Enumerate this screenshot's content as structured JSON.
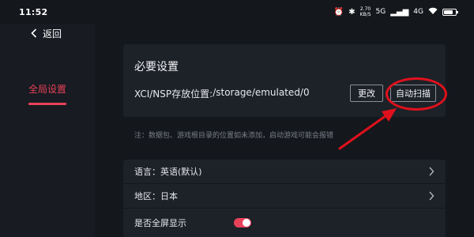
{
  "status_bar": {
    "time": "11:52",
    "net_speed_value": "2.70",
    "net_speed_unit": "KB/S",
    "signal_label": "5G",
    "signal2_label": "4G"
  },
  "sidebar": {
    "back_label": "返回",
    "tabs": [
      {
        "label": "全局设置",
        "active": true
      }
    ]
  },
  "main": {
    "section_title": "必要设置",
    "path_label": "XCI/NSP存放位置:",
    "path_value": "/storage/emulated/0",
    "change_button": "更改",
    "scan_button": "自动扫描",
    "note": "注：数据包、游戏根目录的位置如未添加，启动游戏可能会报错",
    "settings": [
      {
        "label": "语言：英语(默认)",
        "type": "link"
      },
      {
        "label": "地区：日本",
        "type": "link"
      },
      {
        "label": "是否全屏显示",
        "type": "toggle",
        "on": true
      }
    ]
  },
  "colors": {
    "accent": "#e8415a",
    "annotation": "#e0111c",
    "background": "#14171c",
    "card": "#1d2128"
  }
}
